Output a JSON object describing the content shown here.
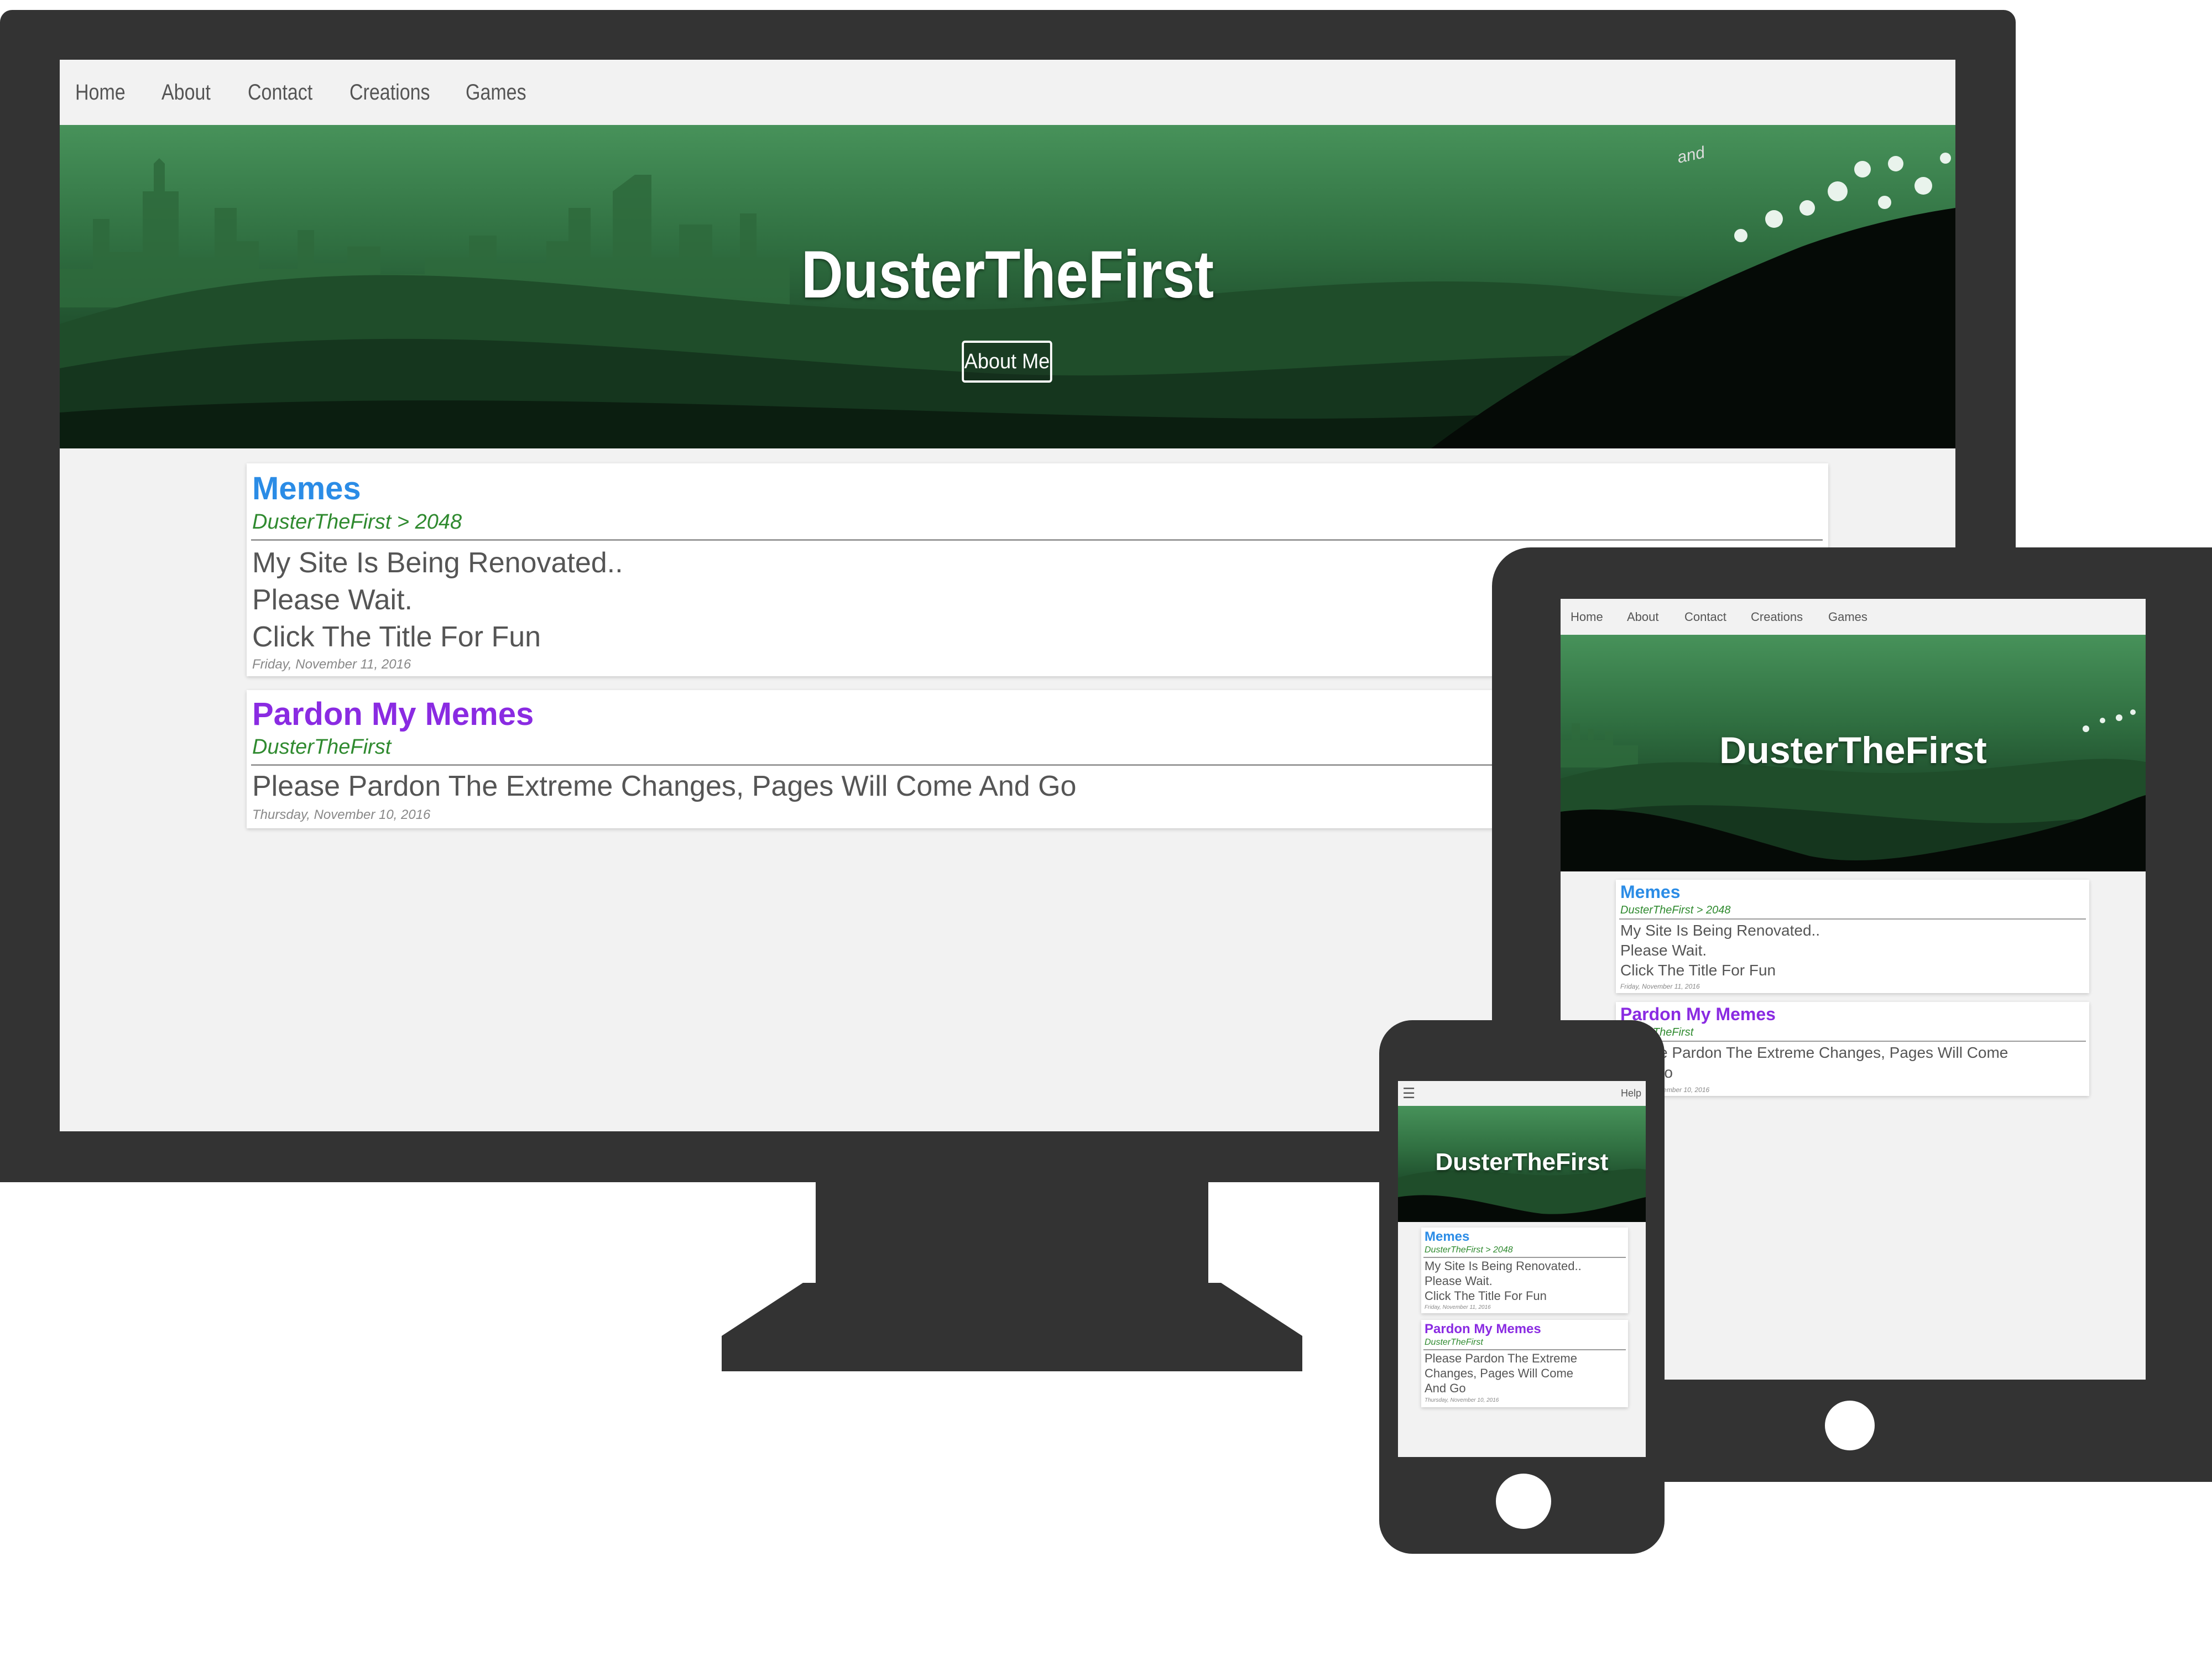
{
  "nav": {
    "items": [
      "Home",
      "About",
      "Contact",
      "Creations",
      "Games"
    ],
    "help": "Help"
  },
  "hero": {
    "title": "DusterTheFirst",
    "button": "About Me",
    "sign": "and"
  },
  "posts": [
    {
      "title": "Memes",
      "subtitle": "DusterTheFirst > 2048",
      "lines": [
        "My Site Is Being Renovated..",
        "Please Wait.",
        "Click The Title For Fun"
      ],
      "date": "Friday, November 11, 2016",
      "title_color": "#2b8ce6"
    },
    {
      "title": "Pardon My Memes",
      "subtitle": "DusterTheFirst",
      "lines": [
        "Please Pardon The Extreme Changes, Pages Will Come And Go"
      ],
      "date": "Thursday, November 10, 2016",
      "title_color": "#8a2be2"
    }
  ],
  "phone_post2_lines": [
    "Please Pardon The Extreme",
    "Changes, Pages Will Come",
    "And Go"
  ],
  "tablet_post2_lines": [
    "Please Pardon The Extreme Changes, Pages Will Come",
    "And Go"
  ],
  "icons": {
    "menu": "hamburger-menu-icon"
  },
  "colors": {
    "device": "#333333",
    "page_bg": "#f2f2f2",
    "post1": "#2b8ce6",
    "post2": "#8a2be2",
    "subtitle": "#2f8a2f"
  }
}
